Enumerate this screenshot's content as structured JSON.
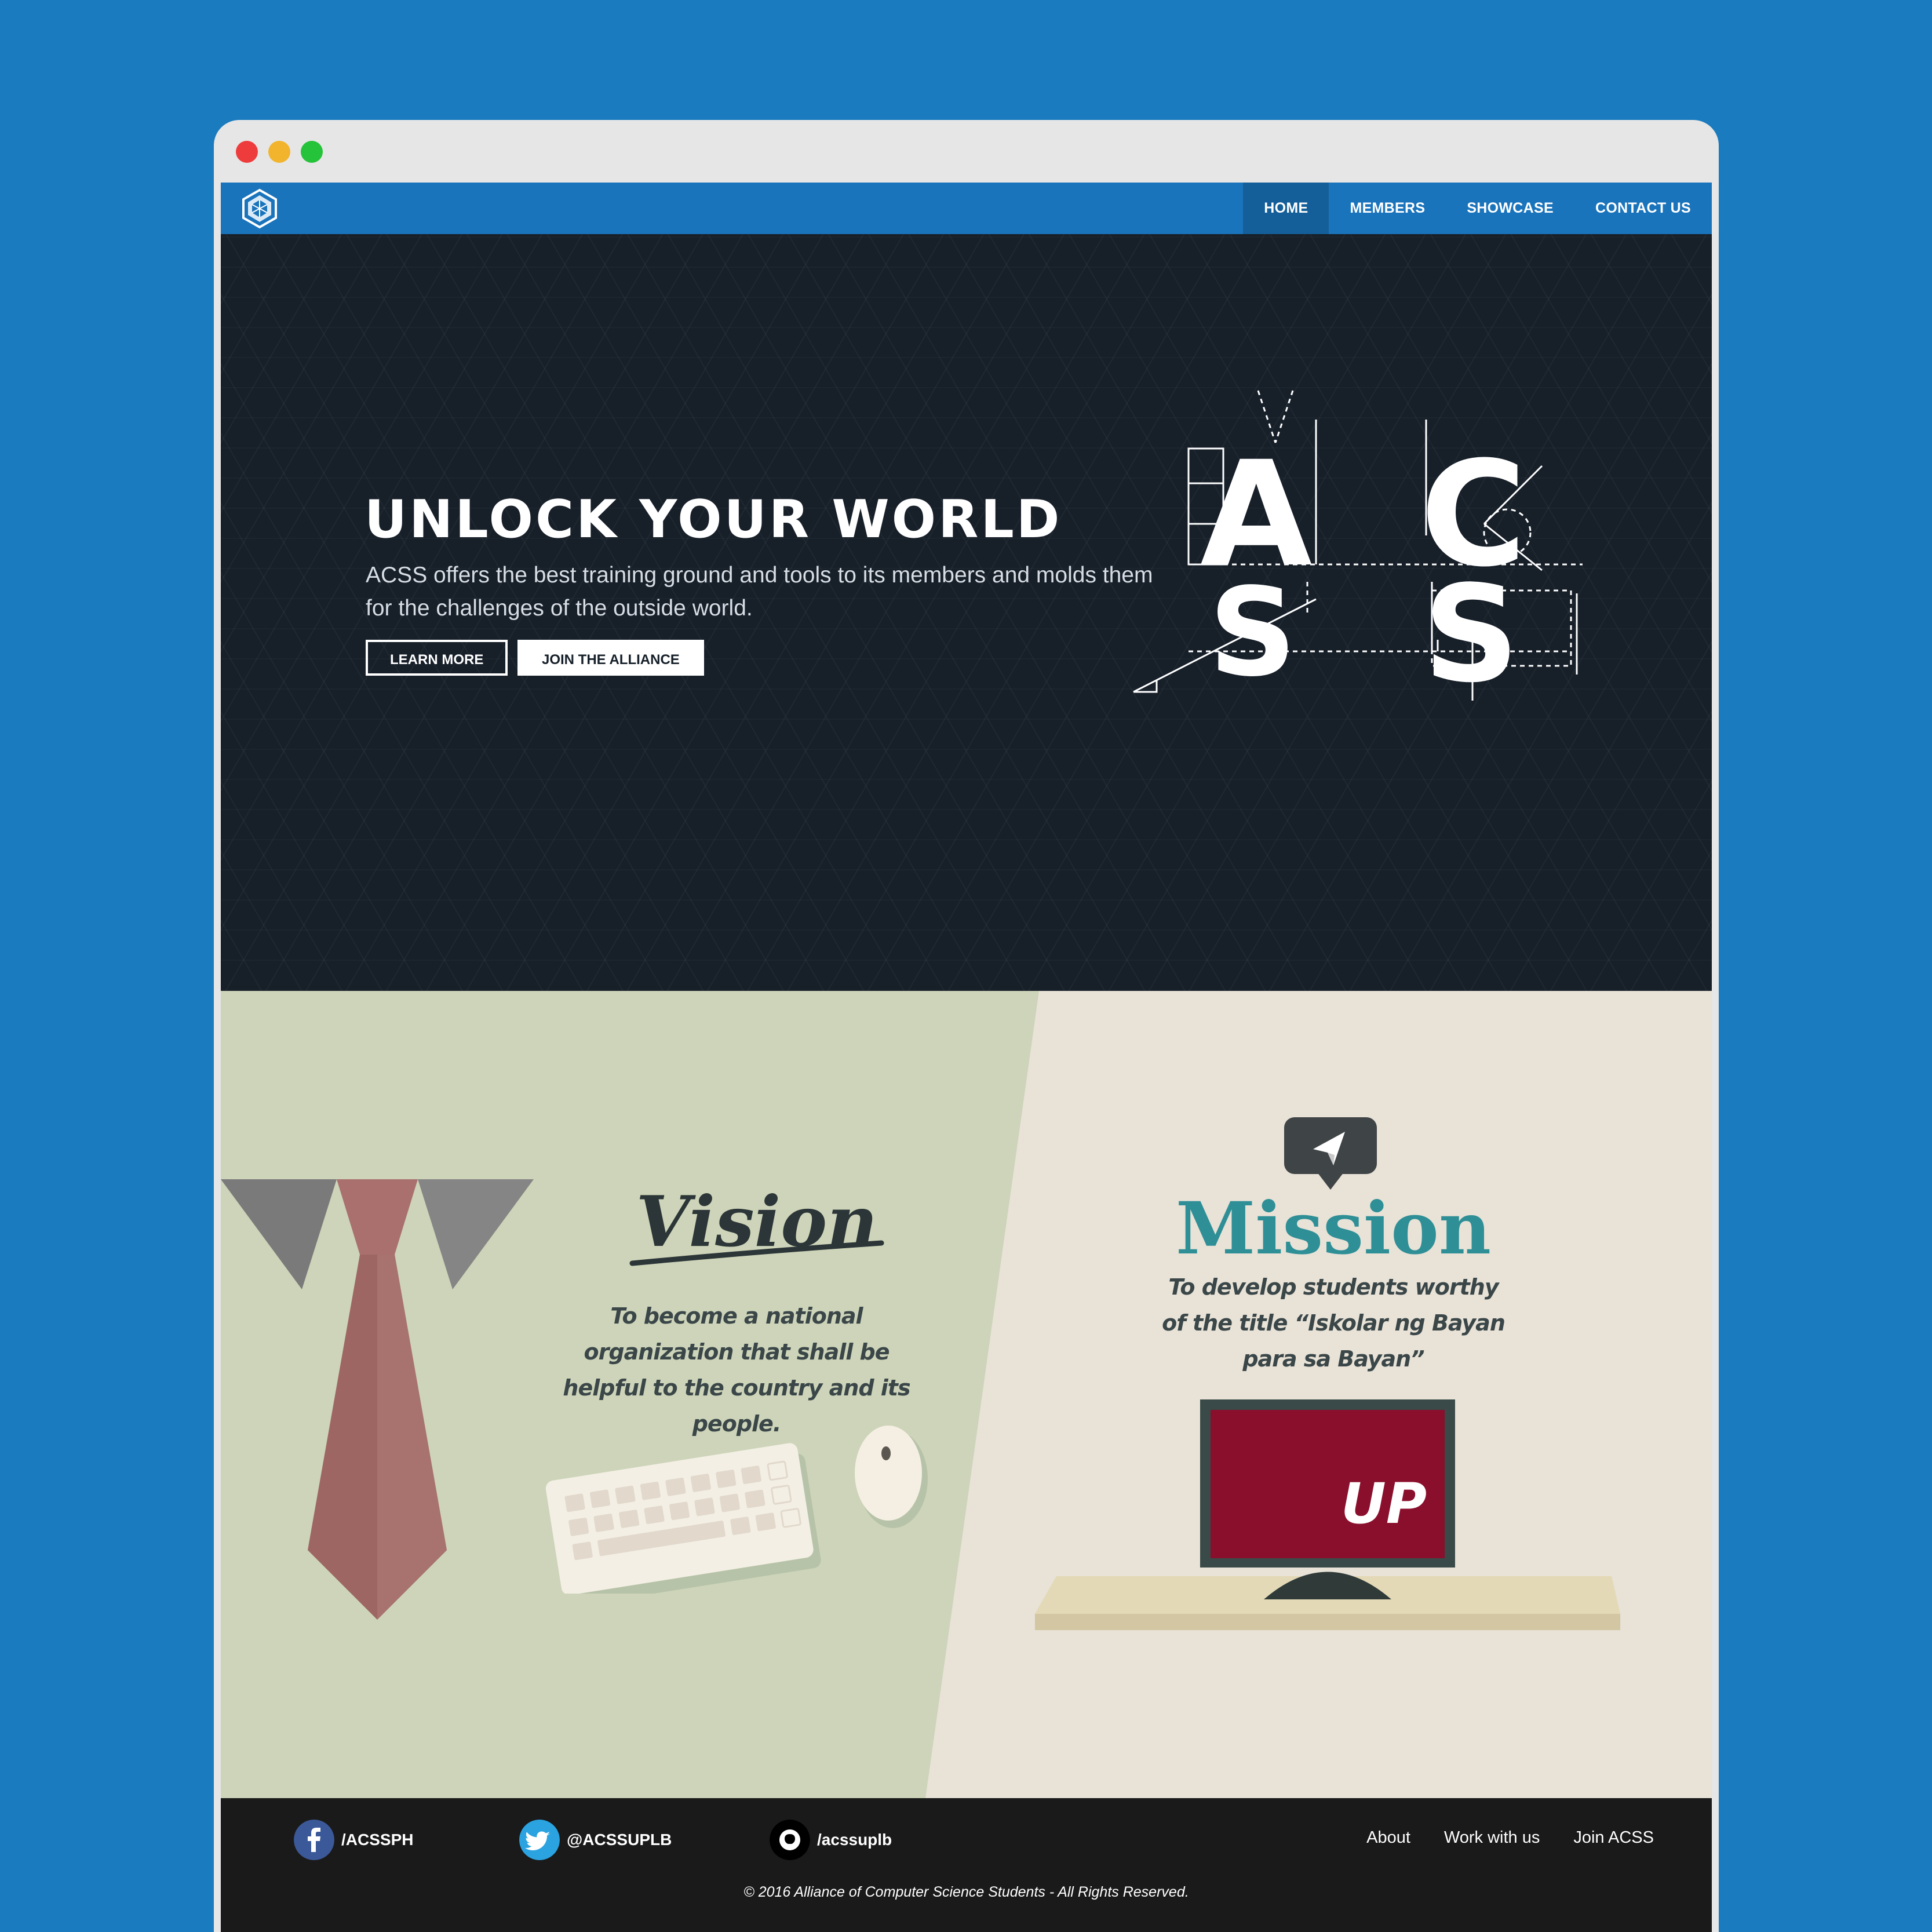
{
  "nav": {
    "items": [
      {
        "label": "HOME",
        "active": true
      },
      {
        "label": "MEMBERS"
      },
      {
        "label": "SHOWCASE"
      },
      {
        "label": "CONTACT US"
      }
    ]
  },
  "hero": {
    "title": "UNLOCK YOUR WORLD",
    "text": "ACSS offers the best training ground and tools to its members and molds them for the challenges of the outside world.",
    "learn_more": "LEARN MORE",
    "join": "JOIN THE ALLIANCE",
    "logo_letters": [
      "A",
      "C",
      "S",
      "S"
    ]
  },
  "vision": {
    "title": "Vision",
    "text": "To become a national organization that shall be helpful to the country and its people."
  },
  "mission": {
    "title": "Mission",
    "text": "To develop students worthy of the title “Iskolar ng Bayan para sa Bayan”",
    "monitor_text": "UP"
  },
  "footer": {
    "facebook": "/ACSSPH",
    "twitter": "@ACSSUPLB",
    "github": "/acssuplb",
    "links": [
      "About",
      "Work with us",
      "Join ACSS"
    ],
    "copyright": "© 2016 Alliance of Computer Science Students - All Rights Reserved."
  },
  "colors": {
    "background": "#1a7bbf",
    "navbar": "#1a74bc",
    "hero": "#171f29",
    "vision_panel": "#cdd4b9",
    "mission_panel": "#e8e2d7",
    "mission_title": "#2e8f96",
    "monitor_screen": "#8a0f2c",
    "footer": "#1a1a1a"
  },
  "icons": [
    "acss-logo-icon",
    "paper-plane-icon",
    "facebook-icon",
    "twitter-icon",
    "github-icon"
  ]
}
